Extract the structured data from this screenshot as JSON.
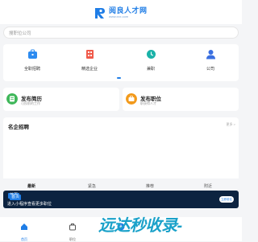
{
  "header": {
    "logo_name": "阅良人才网",
    "logo_url": "www.xxx.com"
  },
  "search": {
    "placeholder": "搜职位公司"
  },
  "categories": [
    {
      "label": "全职招聘",
      "icon": "briefcase-icon"
    },
    {
      "label": "精选企业",
      "icon": "building-icon"
    },
    {
      "label": "兼职",
      "icon": "clock-icon"
    },
    {
      "label": "公司",
      "icon": "person-icon"
    }
  ],
  "cards": [
    {
      "title": "发布简历",
      "sub": "可投前的工作",
      "icon": "resume-icon"
    },
    {
      "title": "发布职位",
      "sub": "职获得人才",
      "icon": "post-job-icon"
    }
  ],
  "jobs": {
    "title": "名企招聘",
    "more": "更多 >"
  },
  "tabs": [
    {
      "label": "最新"
    },
    {
      "label": "紧急"
    },
    {
      "label": "推荐"
    },
    {
      "label": "附近"
    }
  ],
  "banner": {
    "badge1": "首页",
    "badge2": "首页",
    "text": "进入小程序查看更多职位",
    "button": "立即前往"
  },
  "bottom_nav": [
    {
      "label": "首页",
      "icon": "home-icon"
    },
    {
      "label": "职位",
      "icon": "bag-icon"
    },
    {
      "label": "",
      "icon": "add-icon"
    },
    {
      "label": "",
      "icon": "chat-icon"
    },
    {
      "label": "",
      "icon": "user-icon"
    }
  ],
  "watermark": "远达秒收录-",
  "colors": {
    "accent": "#1f7de6",
    "background": "#f4f5f7",
    "banner": "#0c2340",
    "watermark": "#1aa1c9"
  }
}
